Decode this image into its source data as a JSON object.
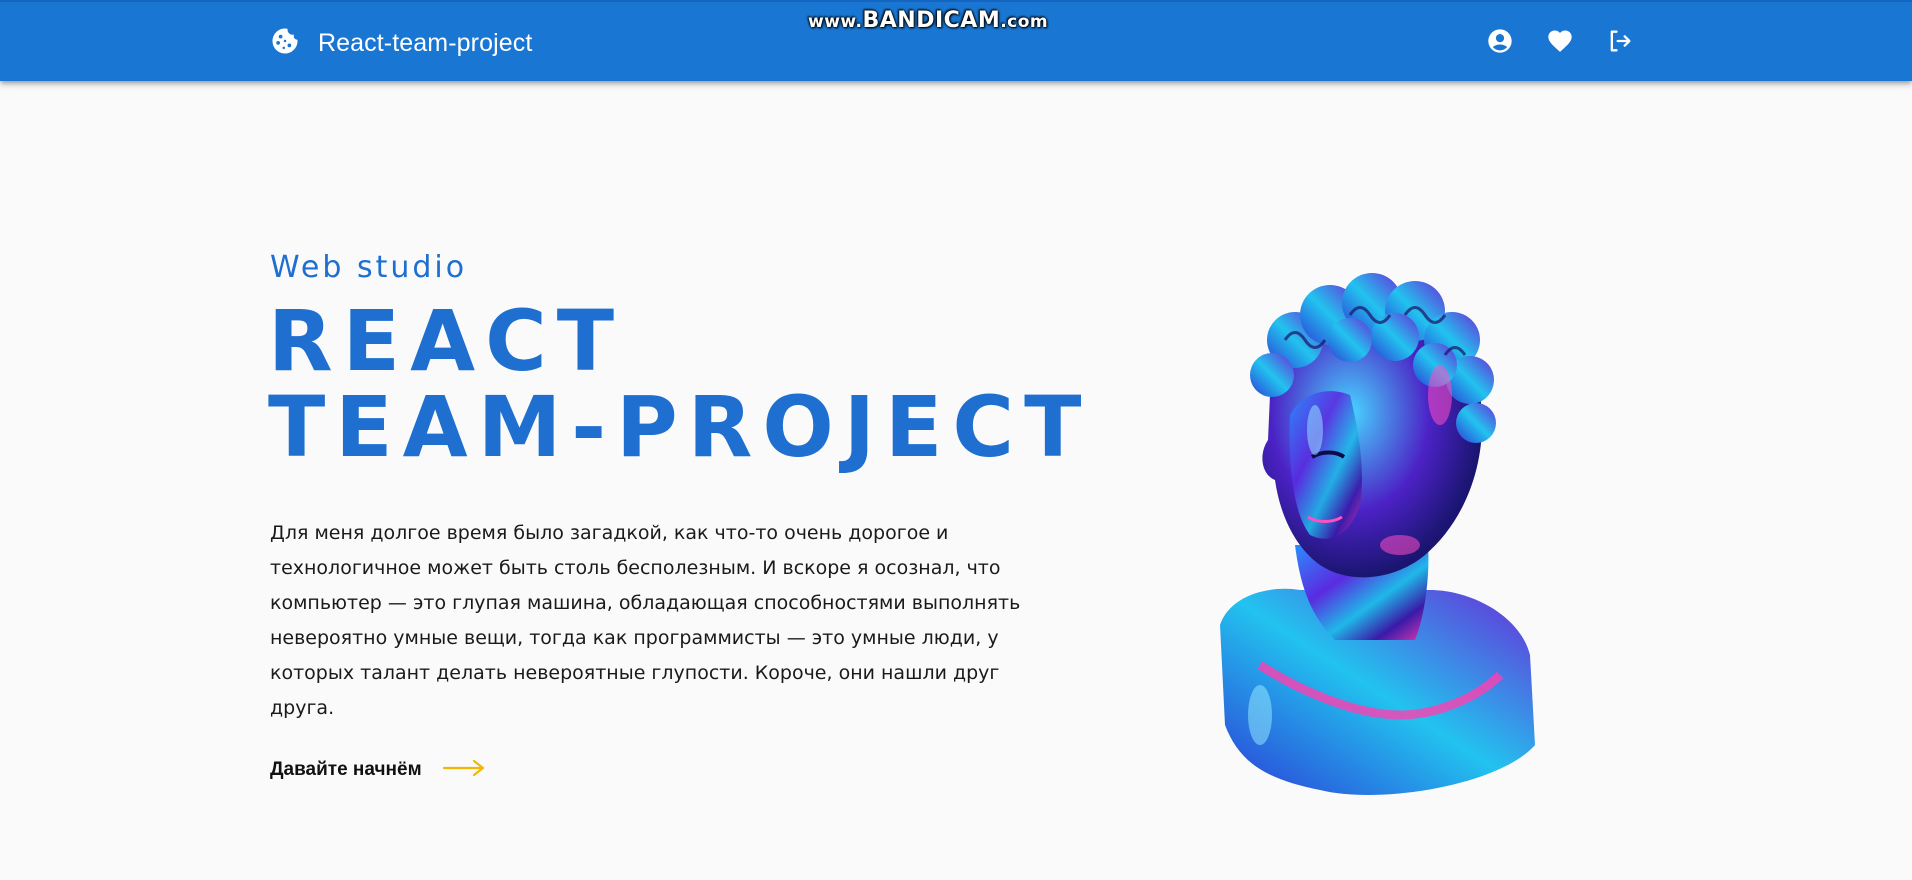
{
  "header": {
    "brand_icon": "cookie-icon",
    "title": "React-team-project",
    "actions": [
      {
        "icon": "account-circle-icon"
      },
      {
        "icon": "heart-icon"
      },
      {
        "icon": "logout-icon"
      }
    ],
    "color": "#1976d2"
  },
  "watermark": {
    "text_prefix": "www.",
    "text_main": "BANDICAM",
    "text_suffix": ".com"
  },
  "hero": {
    "eyebrow": "Web studio",
    "headline_line1": "REACT",
    "headline_line2": "TEAM-PROJECT",
    "paragraph": "Для меня долгое время было загадкой, как что-то очень дорогое и технологичное может быть столь бесполезным. И вскоре я осознал, что компьютер — это глупая машина, обладающая способностями выполнять невероятно умные вещи, тогда как программисты — это умные люди, у которых талант делать невероятные глупости. Короче, они нашли друг друга.",
    "cta_label": "Давайте начнём",
    "cta_icon": "arrow-right-icon",
    "accent_color": "#1e6fd0",
    "arrow_color": "#f2b705"
  },
  "image": {
    "subject": "holographic-bust-image"
  }
}
